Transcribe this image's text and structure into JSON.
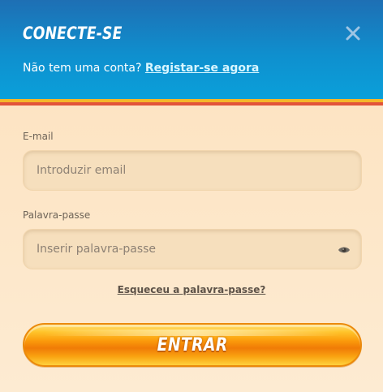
{
  "header": {
    "title": "CONECTE-SE",
    "no_account_text": "Não tem uma conta?",
    "signup_link": "Registar-se agora"
  },
  "form": {
    "email": {
      "label": "E-mail",
      "placeholder": "Introduzir email",
      "value": ""
    },
    "password": {
      "label": "Palavra-passe",
      "placeholder": "Inserir palavra-passe",
      "value": ""
    },
    "forgot_link": "Esqueceu a palavra-passe?",
    "submit_label": "ENTRAR"
  },
  "icons": {
    "close": "close-icon",
    "password_toggle": "eye-icon"
  },
  "colors": {
    "header_gradient_top": "#1e6fb4",
    "header_gradient_bottom": "#0aa0da",
    "link": "#d8f6ff",
    "stripe_yellow": "#f5b62a",
    "stripe_red": "#e2533a",
    "panel_background": "#fde9cf",
    "button_orange": "#f07b06"
  }
}
